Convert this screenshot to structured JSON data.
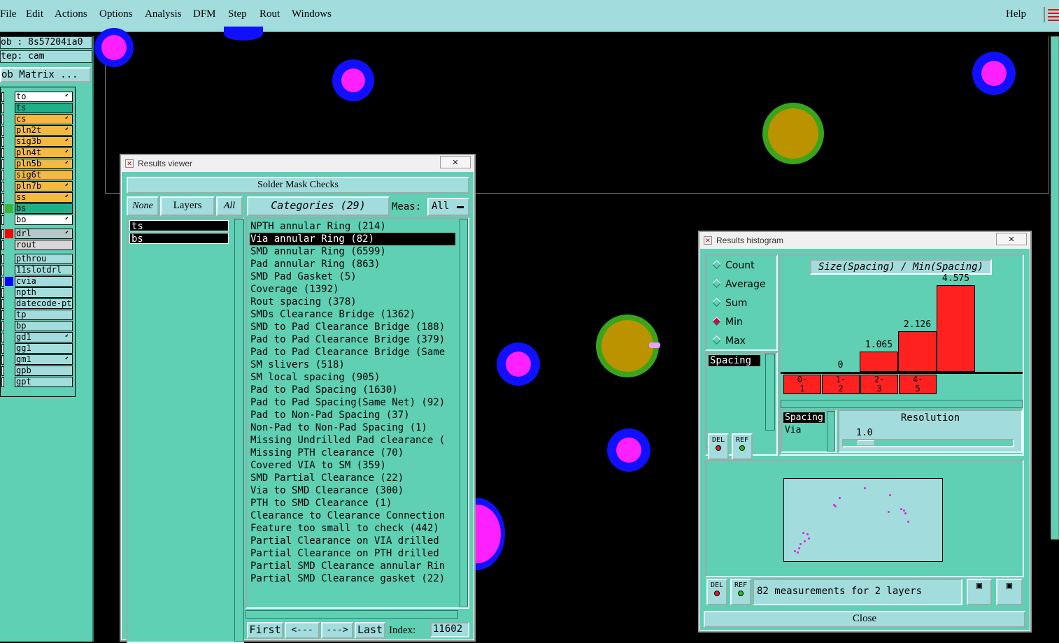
{
  "menubar": {
    "items": [
      "File",
      "Edit",
      "Actions",
      "Options",
      "Analysis",
      "DFM",
      "Step",
      "Rout",
      "Windows"
    ],
    "help": "Help"
  },
  "left": {
    "job": "ob : 8s57204ia0",
    "step": "tep: cam",
    "matrix_button": "ob Matrix ...",
    "layers": [
      {
        "name": "to",
        "color": "#ffffff",
        "arrow": true
      },
      {
        "name": "ts",
        "color": "#1fb08a",
        "arrow": false
      },
      {
        "name": "cs",
        "color": "#f4b942",
        "arrow": true
      },
      {
        "name": "pln2t",
        "color": "#f4b942",
        "arrow": true
      },
      {
        "name": "sig3b",
        "color": "#f4b942",
        "arrow": true
      },
      {
        "name": "pln4t",
        "color": "#f4b942",
        "arrow": true
      },
      {
        "name": "pln5b",
        "color": "#f4b942",
        "arrow": true
      },
      {
        "name": "sig6t",
        "color": "#f4b942",
        "arrow": false
      },
      {
        "name": "pln7b",
        "color": "#f4b942",
        "arrow": true
      },
      {
        "name": "ss",
        "color": "#f4b942",
        "arrow": true
      },
      {
        "name": "bs",
        "color": "#1fb08a",
        "arrow": false
      },
      {
        "name": "bo",
        "color": "#ffffff",
        "arrow": true
      },
      {
        "name": "drl",
        "color": "#b8c8c8",
        "arrow": true
      },
      {
        "name": "rout",
        "color": "#d8d8d8",
        "arrow": false
      },
      {
        "name": "pthrou",
        "color": "#a3dcdc",
        "arrow": false
      },
      {
        "name": "11slotdrl",
        "color": "#a3dcdc",
        "arrow": false
      },
      {
        "name": "cvia",
        "color": "#a3dcdc",
        "arrow": false
      },
      {
        "name": "npth",
        "color": "#a3dcdc",
        "arrow": false
      },
      {
        "name": "datecode-pt",
        "color": "#a3dcdc",
        "arrow": false
      },
      {
        "name": "tp",
        "color": "#a3dcdc",
        "arrow": false
      },
      {
        "name": "bp",
        "color": "#a3dcdc",
        "arrow": false
      },
      {
        "name": "gd1",
        "color": "#a3dcdc",
        "arrow": true
      },
      {
        "name": "gg1",
        "color": "#a3dcdc",
        "arrow": false
      },
      {
        "name": "gm1",
        "color": "#a3dcdc",
        "arrow": true
      },
      {
        "name": "gpb",
        "color": "#a3dcdc",
        "arrow": false
      },
      {
        "name": "gpt",
        "color": "#a3dcdc",
        "arrow": false
      }
    ],
    "swatches": {
      "bs": "#3cb43c",
      "drl": "#ff0000",
      "cvia": "#0000ff"
    }
  },
  "results_viewer": {
    "title": "Results viewer",
    "header": "Solder Mask Checks",
    "none_btn": "None",
    "layers_btn": "Layers",
    "all_btn": "All",
    "layer_items": [
      "ts",
      "bs"
    ],
    "categories_btn": "Categories (29)",
    "meas_label": "Meas:",
    "meas_value": "All",
    "categories": [
      "NPTH annular Ring (214)",
      "Via annular Ring (82)",
      "SMD annular Ring (6599)",
      "Pad annular Ring (863)",
      "SMD Pad Gasket (5)",
      "Coverage (1392)",
      "Rout spacing (378)",
      "SMDs Clearance Bridge (1362)",
      "SMD to Pad Clearance Bridge (188)",
      "Pad to Pad Clearance Bridge (379)",
      "Pad to Pad Clearance Bridge (Same",
      "SM slivers (518)",
      "SM local spacing (905)",
      "Pad to Pad Spacing (1630)",
      "Pad to Pad Spacing(Same Net) (92)",
      "Pad to Non-Pad Spacing (37)",
      "Non-Pad to Non-Pad Spacing (1)",
      "Missing Undrilled Pad clearance (",
      "Missing PTH clearance (70)",
      "Covered VIA to SM (359)",
      "SMD Partial Clearance (22)",
      "Via to SMD Clearance (300)",
      "PTH to SMD Clearance (1)",
      "Clearance to Clearance Connection",
      "Feature too small to check (442)",
      "Partial Clearance on VIA drilled",
      "Partial Clearance on PTH drilled",
      "Partial SMD Clearance annular Rin",
      "Partial SMD Clearance gasket (22)"
    ],
    "selected_index": 1,
    "nav": {
      "first": "First",
      "prev": "<---",
      "next": "--->",
      "last": "Last",
      "index_label": "Index:",
      "index_value": "11602"
    }
  },
  "histogram": {
    "title": "Results histogram",
    "modes": [
      "Count",
      "Average",
      "Sum",
      "Min",
      "Max"
    ],
    "selected_mode": "Min",
    "list_item": "Spacing",
    "chart_title": "Size(Spacing) / Min(Spacing)",
    "chart_data": {
      "type": "bar",
      "title": "Size(Spacing) / Min(Spacing)",
      "categories": [
        "0-1",
        "1-2",
        "2-3",
        "4-5"
      ],
      "values": [
        0,
        1.065,
        2.126,
        4.575
      ],
      "value_labels": [
        "0",
        "1.065",
        "2.126",
        "4.575"
      ]
    },
    "bin_labels": [
      [
        "0-",
        "1"
      ],
      [
        "1-",
        "2"
      ],
      [
        "2-",
        "3"
      ],
      [
        "4-",
        "5"
      ]
    ],
    "sel_list": [
      "Spacing",
      "Via"
    ],
    "resolution_label": "Resolution",
    "resolution_value": "1.0",
    "del_label": "DEL",
    "ref_label": "REF",
    "status": "82 measurements for 2 layers",
    "close": "Close"
  }
}
